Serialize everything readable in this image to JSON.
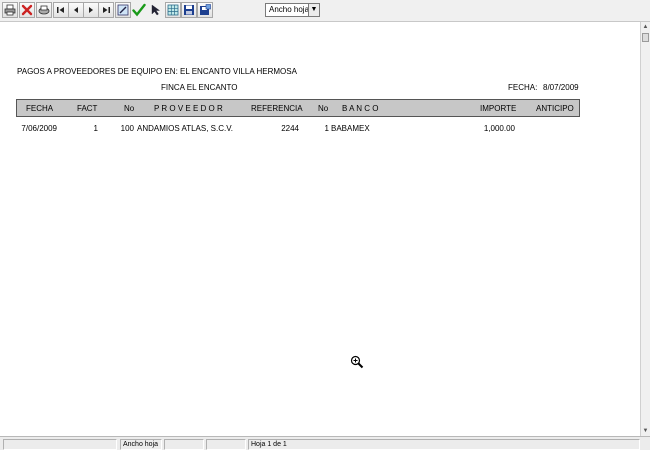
{
  "toolbar": {
    "buttons": [
      {
        "name": "print-icon"
      },
      {
        "name": "close-icon",
        "color": "#cc2222"
      },
      {
        "name": "printer-setup-icon"
      },
      {
        "name": "first-page-icon"
      },
      {
        "name": "previous-page-icon"
      },
      {
        "name": "next-page-icon"
      },
      {
        "name": "last-page-icon"
      },
      {
        "name": "edit-icon"
      },
      {
        "name": "checkmark-icon",
        "color": "#1a9a1a"
      },
      {
        "name": "pointer-icon"
      },
      {
        "name": "grid-icon"
      },
      {
        "name": "save-icon"
      },
      {
        "name": "export-icon"
      }
    ],
    "zoom_value": "Ancho hoja"
  },
  "report": {
    "title_line": "PAGOS A PROVEEDORES DE EQUIPO EN:  EL ENCANTO VILLA HERMOSA",
    "subtitle_line": "FINCA EL ENCANTO",
    "fecha_label": "FECHA:",
    "fecha_value": "8/07/2009",
    "columns": {
      "fecha": "FECHA",
      "fact": "FACT",
      "no": "No",
      "proveedor": "P R O V E E D O R",
      "referencia": "REFERENCIA",
      "no2": "No",
      "banco": "B A N C O",
      "importe": "IMPORTE",
      "anticipo": "ANTICIPO"
    },
    "rows": [
      {
        "fecha": "7/06/2009",
        "fact": "1",
        "no": "100",
        "proveedor": "ANDAMIOS ATLAS, S.C.V.",
        "referencia": "2244",
        "no2": "1",
        "banco": "BABAMEX",
        "importe": "1,000.00",
        "anticipo": ""
      }
    ]
  },
  "statusbar": {
    "zoom_text": "Ancho hoja",
    "page_text": "Hoja 1 de 1"
  }
}
